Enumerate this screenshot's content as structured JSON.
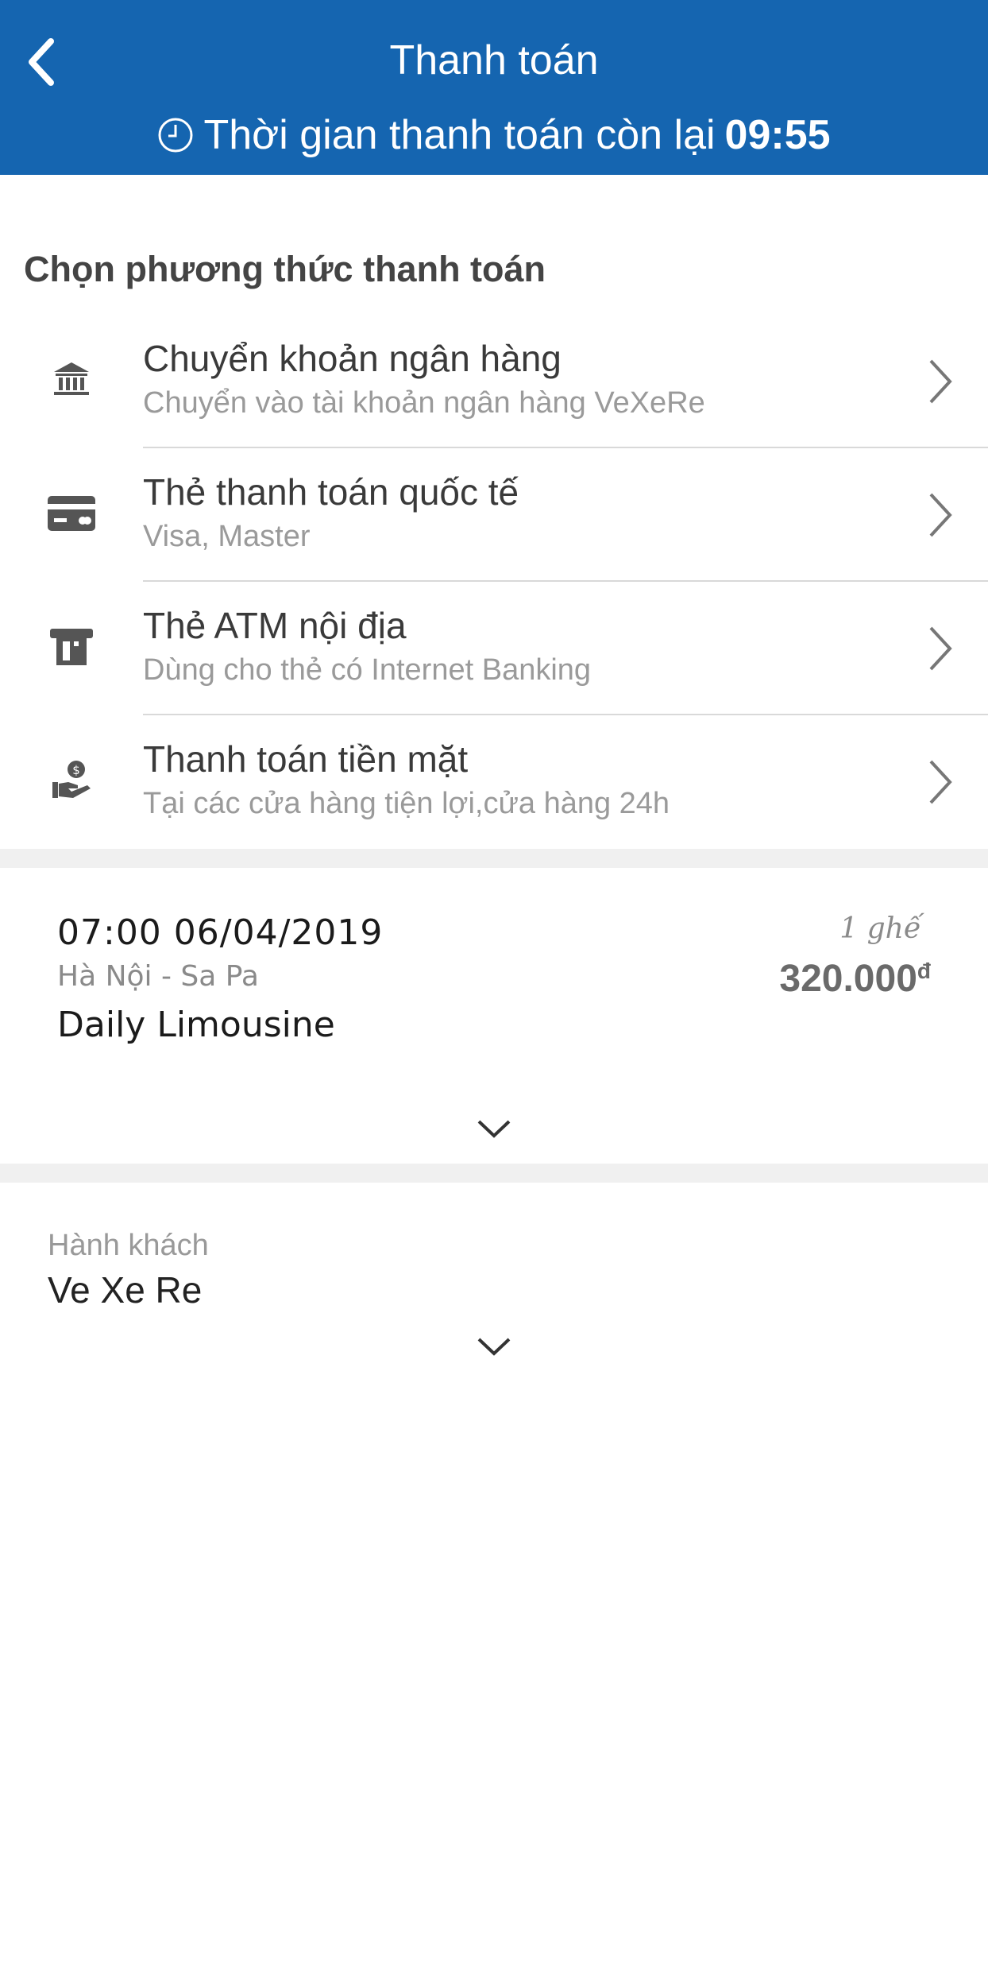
{
  "header": {
    "title": "Thanh toán",
    "timer_label": "Thời gian thanh toán còn lại",
    "timer_value": "09:55",
    "background": "#1565b0"
  },
  "payment": {
    "section_title": "Chọn phương thức thanh toán",
    "methods": [
      {
        "icon": "bank-icon",
        "title": "Chuyển khoản ngân hàng",
        "subtitle": "Chuyển vào tài khoản ngân hàng VeXeRe"
      },
      {
        "icon": "credit-card-icon",
        "title": "Thẻ thanh toán quốc tế",
        "subtitle": "Visa, Master"
      },
      {
        "icon": "atm-icon",
        "title": "Thẻ ATM nội địa",
        "subtitle": "Dùng cho thẻ có Internet Banking"
      },
      {
        "icon": "cash-hand-icon",
        "title": "Thanh toán tiền mặt",
        "subtitle": "Tại các cửa hàng tiện lợi,cửa hàng 24h"
      }
    ]
  },
  "trip": {
    "datetime": "07:00 06/04/2019",
    "route": "Hà Nội - Sa Pa",
    "company": "Daily Limousine",
    "seats": "1 ghế",
    "price": "320.000",
    "currency": "đ"
  },
  "passenger": {
    "label": "Hành khách",
    "name": "Ve Xe Re"
  }
}
